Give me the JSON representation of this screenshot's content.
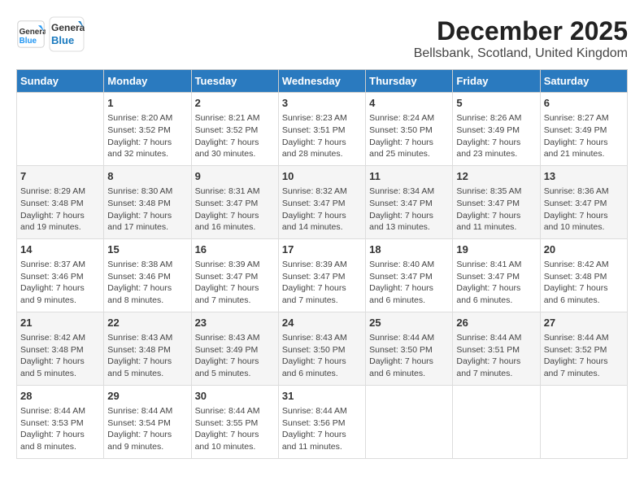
{
  "logo": {
    "line1": "General",
    "line2": "Blue"
  },
  "title": "December 2025",
  "subtitle": "Bellsbank, Scotland, United Kingdom",
  "columns": [
    "Sunday",
    "Monday",
    "Tuesday",
    "Wednesday",
    "Thursday",
    "Friday",
    "Saturday"
  ],
  "weeks": [
    [
      {
        "day": "",
        "sunrise": "",
        "sunset": "",
        "daylight": ""
      },
      {
        "day": "1",
        "sunrise": "8:20 AM",
        "sunset": "3:52 PM",
        "daylight": "7 hours and 32 minutes."
      },
      {
        "day": "2",
        "sunrise": "8:21 AM",
        "sunset": "3:52 PM",
        "daylight": "7 hours and 30 minutes."
      },
      {
        "day": "3",
        "sunrise": "8:23 AM",
        "sunset": "3:51 PM",
        "daylight": "7 hours and 28 minutes."
      },
      {
        "day": "4",
        "sunrise": "8:24 AM",
        "sunset": "3:50 PM",
        "daylight": "7 hours and 25 minutes."
      },
      {
        "day": "5",
        "sunrise": "8:26 AM",
        "sunset": "3:49 PM",
        "daylight": "7 hours and 23 minutes."
      },
      {
        "day": "6",
        "sunrise": "8:27 AM",
        "sunset": "3:49 PM",
        "daylight": "7 hours and 21 minutes."
      }
    ],
    [
      {
        "day": "7",
        "sunrise": "8:29 AM",
        "sunset": "3:48 PM",
        "daylight": "7 hours and 19 minutes."
      },
      {
        "day": "8",
        "sunrise": "8:30 AM",
        "sunset": "3:48 PM",
        "daylight": "7 hours and 17 minutes."
      },
      {
        "day": "9",
        "sunrise": "8:31 AM",
        "sunset": "3:47 PM",
        "daylight": "7 hours and 16 minutes."
      },
      {
        "day": "10",
        "sunrise": "8:32 AM",
        "sunset": "3:47 PM",
        "daylight": "7 hours and 14 minutes."
      },
      {
        "day": "11",
        "sunrise": "8:34 AM",
        "sunset": "3:47 PM",
        "daylight": "7 hours and 13 minutes."
      },
      {
        "day": "12",
        "sunrise": "8:35 AM",
        "sunset": "3:47 PM",
        "daylight": "7 hours and 11 minutes."
      },
      {
        "day": "13",
        "sunrise": "8:36 AM",
        "sunset": "3:47 PM",
        "daylight": "7 hours and 10 minutes."
      }
    ],
    [
      {
        "day": "14",
        "sunrise": "8:37 AM",
        "sunset": "3:46 PM",
        "daylight": "7 hours and 9 minutes."
      },
      {
        "day": "15",
        "sunrise": "8:38 AM",
        "sunset": "3:46 PM",
        "daylight": "7 hours and 8 minutes."
      },
      {
        "day": "16",
        "sunrise": "8:39 AM",
        "sunset": "3:47 PM",
        "daylight": "7 hours and 7 minutes."
      },
      {
        "day": "17",
        "sunrise": "8:39 AM",
        "sunset": "3:47 PM",
        "daylight": "7 hours and 7 minutes."
      },
      {
        "day": "18",
        "sunrise": "8:40 AM",
        "sunset": "3:47 PM",
        "daylight": "7 hours and 6 minutes."
      },
      {
        "day": "19",
        "sunrise": "8:41 AM",
        "sunset": "3:47 PM",
        "daylight": "7 hours and 6 minutes."
      },
      {
        "day": "20",
        "sunrise": "8:42 AM",
        "sunset": "3:48 PM",
        "daylight": "7 hours and 6 minutes."
      }
    ],
    [
      {
        "day": "21",
        "sunrise": "8:42 AM",
        "sunset": "3:48 PM",
        "daylight": "7 hours and 5 minutes."
      },
      {
        "day": "22",
        "sunrise": "8:43 AM",
        "sunset": "3:48 PM",
        "daylight": "7 hours and 5 minutes."
      },
      {
        "day": "23",
        "sunrise": "8:43 AM",
        "sunset": "3:49 PM",
        "daylight": "7 hours and 5 minutes."
      },
      {
        "day": "24",
        "sunrise": "8:43 AM",
        "sunset": "3:50 PM",
        "daylight": "7 hours and 6 minutes."
      },
      {
        "day": "25",
        "sunrise": "8:44 AM",
        "sunset": "3:50 PM",
        "daylight": "7 hours and 6 minutes."
      },
      {
        "day": "26",
        "sunrise": "8:44 AM",
        "sunset": "3:51 PM",
        "daylight": "7 hours and 7 minutes."
      },
      {
        "day": "27",
        "sunrise": "8:44 AM",
        "sunset": "3:52 PM",
        "daylight": "7 hours and 7 minutes."
      }
    ],
    [
      {
        "day": "28",
        "sunrise": "8:44 AM",
        "sunset": "3:53 PM",
        "daylight": "7 hours and 8 minutes."
      },
      {
        "day": "29",
        "sunrise": "8:44 AM",
        "sunset": "3:54 PM",
        "daylight": "7 hours and 9 minutes."
      },
      {
        "day": "30",
        "sunrise": "8:44 AM",
        "sunset": "3:55 PM",
        "daylight": "7 hours and 10 minutes."
      },
      {
        "day": "31",
        "sunrise": "8:44 AM",
        "sunset": "3:56 PM",
        "daylight": "7 hours and 11 minutes."
      },
      {
        "day": "",
        "sunrise": "",
        "sunset": "",
        "daylight": ""
      },
      {
        "day": "",
        "sunrise": "",
        "sunset": "",
        "daylight": ""
      },
      {
        "day": "",
        "sunrise": "",
        "sunset": "",
        "daylight": ""
      }
    ]
  ]
}
